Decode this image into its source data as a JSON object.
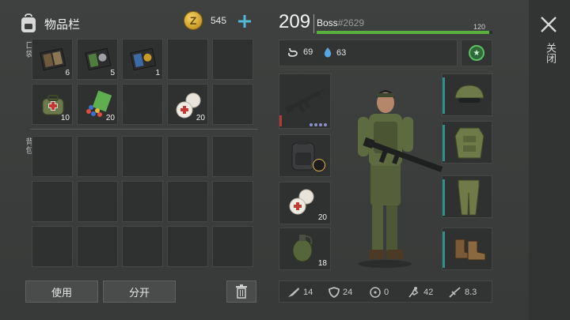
{
  "inventory": {
    "title": "物品栏",
    "pocket_label": "口袋",
    "backpack_label": "背包",
    "coins": "545",
    "pocket_slots": [
      {
        "icon": "notebook-icon",
        "qty": "6"
      },
      {
        "icon": "notebook-badge-icon",
        "qty": "5"
      },
      {
        "icon": "police-badge-icon",
        "qty": "1"
      },
      {
        "icon": "",
        "qty": ""
      },
      {
        "icon": "",
        "qty": ""
      },
      {
        "icon": "medkit-bag-icon",
        "qty": "10"
      },
      {
        "icon": "herbs-pills-icon",
        "qty": "20"
      },
      {
        "icon": "",
        "qty": ""
      },
      {
        "icon": "bandage-icon",
        "qty": "20"
      },
      {
        "icon": "",
        "qty": ""
      }
    ],
    "backpack_slot_count": 15,
    "use_label": "使用",
    "split_label": "分开"
  },
  "character": {
    "level": "209",
    "name": "Boss",
    "tag": "#2629",
    "xp_value": "120",
    "xp_fraction": 0.98,
    "food": "69",
    "water": "63",
    "quick_slots": [
      {
        "icon": "assault-rifle-icon",
        "qty": ""
      },
      {
        "icon": "backpack-icon",
        "qty": ""
      },
      {
        "icon": "bandage-icon",
        "qty": "20"
      },
      {
        "icon": "grenade-icon",
        "qty": "18"
      }
    ],
    "equipment": [
      "helmet-goggles-icon",
      "body-armor-icon",
      "camo-pants-icon",
      "boots-icon"
    ]
  },
  "stats": {
    "attack": "14",
    "defense": "24",
    "radiation": "0",
    "speed": "42",
    "stealth": "8.3"
  },
  "close_label": "关闭",
  "colors": {
    "xp": "#59b03c",
    "accent": "#2f8f8a",
    "coin": "#e3b440"
  }
}
